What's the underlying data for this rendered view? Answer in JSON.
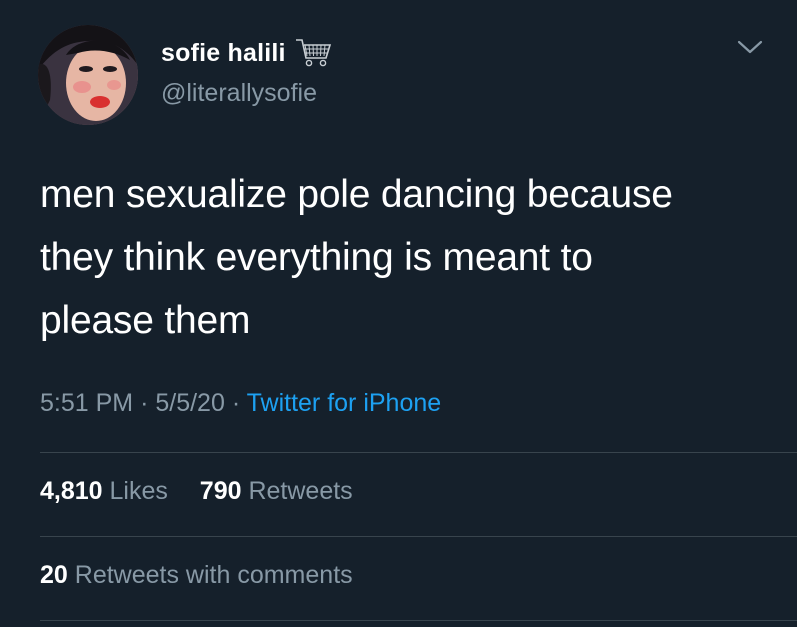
{
  "user": {
    "display_name": "sofie halili",
    "handle": "@literallysofie",
    "name_emoji": "shopping-cart-icon"
  },
  "tweet": {
    "text_lines": [
      "men sexualize pole dancing because",
      "they think everything is meant to",
      "please them"
    ],
    "time": "5:51 PM",
    "separator": "·",
    "date": "5/5/20",
    "source": "Twitter for iPhone"
  },
  "stats": {
    "likes_count": "4,810",
    "likes_label": "Likes",
    "retweets_count": "790",
    "retweets_label": "Retweets",
    "quote_count": "20",
    "quote_label": "Retweets with comments"
  },
  "colors": {
    "background": "#15202b",
    "text": "#ffffff",
    "secondary": "#8899a6",
    "link": "#1da1f2",
    "divider": "#38444d"
  }
}
